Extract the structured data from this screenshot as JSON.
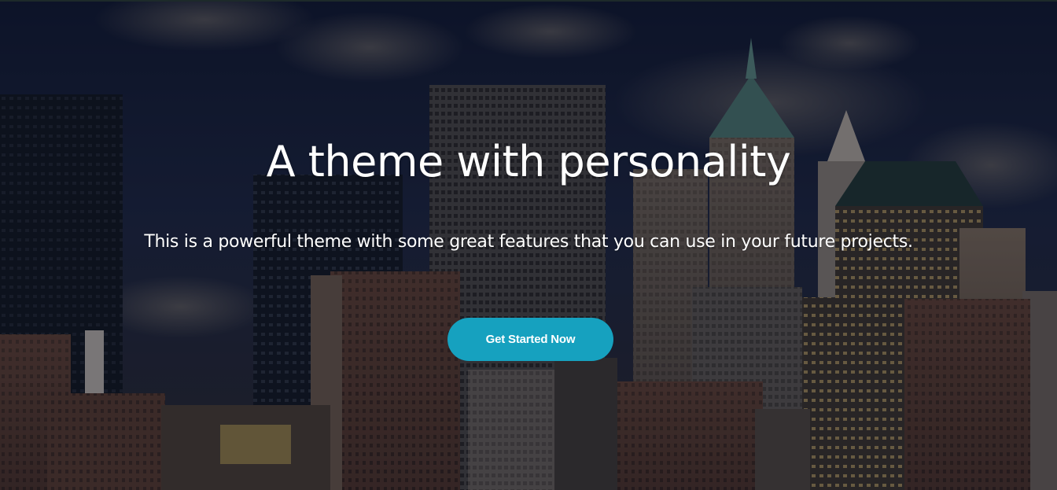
{
  "hero": {
    "title": "A theme with personality",
    "subtitle": "This is a powerful theme with some great features that you can use in your future projects.",
    "cta_label": "Get Started Now"
  },
  "colors": {
    "accent": "#16a1bf",
    "text": "#ffffff",
    "sky": "#101a33"
  },
  "background": {
    "subject": "city-skyline-photo"
  }
}
